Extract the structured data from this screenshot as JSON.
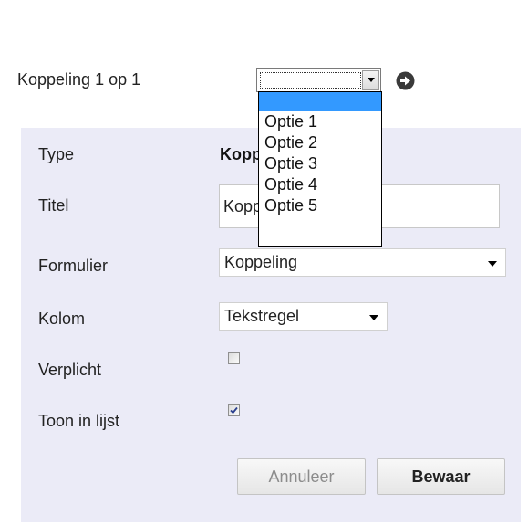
{
  "header": {
    "label": "Koppeling 1 op 1",
    "select_value": "",
    "go_icon": "arrow-right-circle-icon"
  },
  "dropdown": {
    "options": [
      "",
      "Optie 1",
      "Optie 2",
      "Optie 3",
      "Optie 4",
      "Optie 5"
    ],
    "selected_index": 0,
    "highlight_color": "#3399ff"
  },
  "form": {
    "type": {
      "label": "Type",
      "value": "Koppeling 1 op 1"
    },
    "titel": {
      "label": "Titel",
      "value": "Koppeling 1 op 1"
    },
    "formulier": {
      "label": "Formulier",
      "value": "Koppeling"
    },
    "kolom": {
      "label": "Kolom",
      "value": "Tekstregel"
    },
    "verplicht": {
      "label": "Verplicht",
      "checked": false
    },
    "toon_in_lijst": {
      "label": "Toon in lijst",
      "checked": true
    },
    "panel_color": "#ebebf7"
  },
  "buttons": {
    "cancel_label": "Annuleer",
    "save_label": "Bewaar"
  }
}
